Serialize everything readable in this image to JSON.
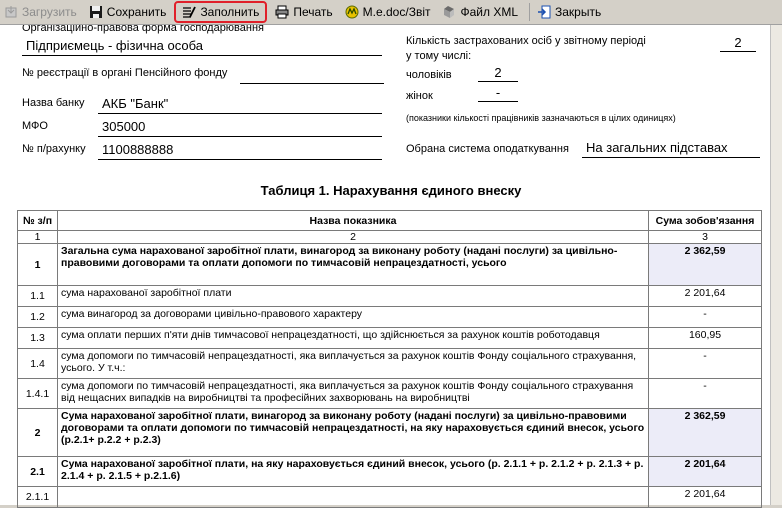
{
  "toolbar": {
    "load": "Загрузить",
    "save": "Сохранить",
    "fill": "Заполнить",
    "print": "Печать",
    "medoc": "M.e.doc/Звіт",
    "xml": "Файл XML",
    "close": "Закрыть"
  },
  "form": {
    "org_form_label": "Організаційно-правова форма господарювання",
    "org_form_value": "Підприємець - фізична особа",
    "pension_reg_label": "№ реєстрації в органі Пенсійного фонду",
    "pension_reg_value": "",
    "bank_label": "Назва банку",
    "bank_value": "АКБ \"Банк\"",
    "mfo_label": "МФО",
    "mfo_value": "305000",
    "account_label": "№ п/рахунку",
    "account_value": "1100888888",
    "insured_label_1": "Кількість застрахованих осіб у звітному періоді",
    "insured_label_2": "у тому числі:",
    "insured_total": "2",
    "men_label": "чоловіків",
    "men_value": "2",
    "women_label": "жінок",
    "women_value": "-",
    "note": "(показники кількості працівників зазначаються в цілих одиницях)",
    "tax_system_label": "Обрана система оподаткування",
    "tax_system_value": "На загальних підставах"
  },
  "table": {
    "title": "Таблиця 1. Нарахування єдиного внеску",
    "headers": [
      "№ з/п",
      "Назва показника",
      "Сума зобов'язання"
    ],
    "index_row": [
      "1",
      "2",
      "3"
    ],
    "rows": [
      {
        "n": "1",
        "name": "Загальна сума нарахованої заробітної плати, винагород за виконану роботу (надані послуги) за цивільно-правовими договорами та оплати допомоги по тимчасовій непрацездатності, усього",
        "amount": "2 362,59",
        "bold": true
      },
      {
        "n": "1.1",
        "name": "сума нарахованої заробітної плати",
        "amount": "2 201,64",
        "bold": false
      },
      {
        "n": "1.2",
        "name": "сума винагород за договорами цивільно-правового характеру",
        "amount": "-",
        "bold": false
      },
      {
        "n": "1.3",
        "name": "сума оплати перших п'яти днів тимчасової непрацездатності, що здійснюється за рахунок коштів роботодавця",
        "amount": "160,95",
        "bold": false
      },
      {
        "n": "1.4",
        "name": "сума допомоги по тимчасовій непрацездатності, яка виплачується за рахунок коштів Фонду соціального страхування, усього. У т.ч.:",
        "amount": "-",
        "bold": false
      },
      {
        "n": "1.4.1",
        "name": "сума допомоги по тимчасовій непрацездатності, яка виплачується за рахунок коштів Фонду соціального страхування від нещасних випадків на виробництві та професійних захворювань на виробництві",
        "amount": "-",
        "bold": false
      },
      {
        "n": "2",
        "name": "Сума нарахованої заробітної плати, винагород за виконану роботу (надані послуги) за цивільно-правовими договорами та оплати допомоги по тимчасовій непрацездатності, на яку нараховується єдиний внесок, усього (р.2.1+ р.2.2 + р.2.3)",
        "amount": "2 362,59",
        "bold": true
      },
      {
        "n": "2.1",
        "name": "Сума нарахованої заробітної плати, на яку нараховується єдиний внесок, усього (р. 2.1.1 + р. 2.1.2 + р. 2.1.3 + р. 2.1.4 + р. 2.1.5 + р.2.1.6)",
        "amount": "2 201,64",
        "bold": true
      },
      {
        "n": "2.1.1",
        "name": "",
        "amount": "2 201,64",
        "bold": false
      }
    ]
  },
  "colors": {
    "highlight_border": "#e0202a",
    "toolbar_bg": "#d4d0c8",
    "amount_shade": "#ececf8"
  }
}
